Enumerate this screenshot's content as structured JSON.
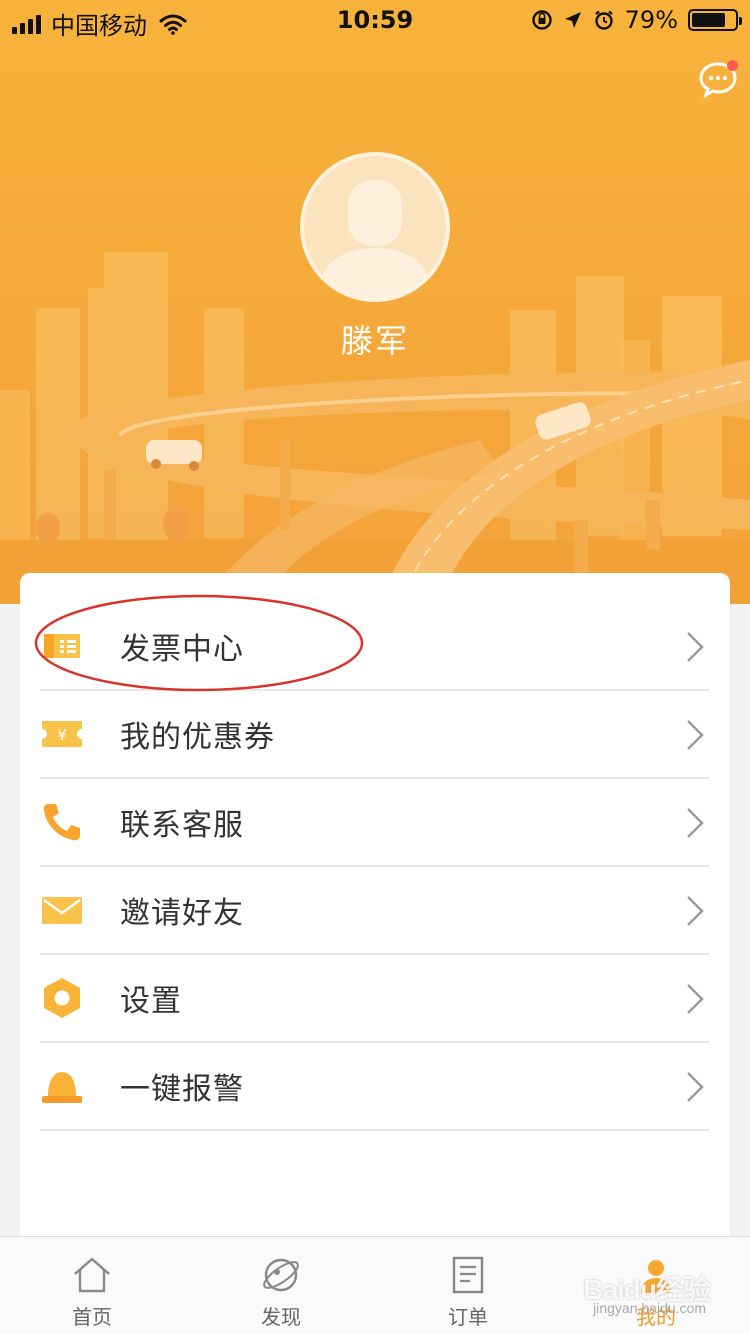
{
  "status_bar": {
    "carrier": "中国移动",
    "time": "10:59",
    "battery_percent": "79%",
    "battery_level": 0.79
  },
  "profile": {
    "username": "滕军"
  },
  "menu": [
    {
      "label": "发票中心",
      "icon": "invoice-icon"
    },
    {
      "label": "我的优惠券",
      "icon": "coupon-icon"
    },
    {
      "label": "联系客服",
      "icon": "phone-icon"
    },
    {
      "label": "邀请好友",
      "icon": "envelope-icon"
    },
    {
      "label": "设置",
      "icon": "settings-hexagon-icon"
    },
    {
      "label": "一键报警",
      "icon": "alarm-bell-icon"
    }
  ],
  "tabs": [
    {
      "label": "首页",
      "icon": "home-icon",
      "active": false
    },
    {
      "label": "发现",
      "icon": "planet-icon",
      "active": false
    },
    {
      "label": "订单",
      "icon": "order-icon",
      "active": false
    },
    {
      "label": "我的",
      "icon": "user-icon",
      "active": true
    }
  ],
  "watermark": {
    "text": "Baidu经验",
    "sub": "jingyan.baidu.com"
  },
  "colors": {
    "brand_orange": "#f6aa3a",
    "active_tab": "#f39c2b",
    "annotation_red": "#d9342b"
  }
}
